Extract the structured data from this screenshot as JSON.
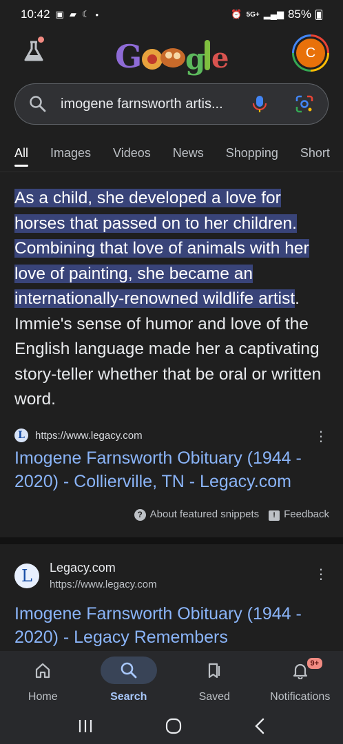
{
  "status_bar": {
    "time": "10:42",
    "network": "5G+",
    "battery": "85%"
  },
  "header": {
    "doodle_alt": "Google",
    "avatar_initial": "C"
  },
  "search": {
    "query": "imogene farnsworth artis..."
  },
  "tabs": [
    "All",
    "Images",
    "Videos",
    "News",
    "Shopping",
    "Short"
  ],
  "snippet": {
    "highlighted": "As a child, she developed a love for horses that passed on to her children. Combining that love of animals with her love of painting, she became an internationally-renowned wildlife artist",
    "rest": ". Immie's sense of humor and love of the English language made her a captivating story-teller whether that be oral or written word.",
    "source_url": "https://www.legacy.com",
    "favicon_letter": "L",
    "title": "Imogene Farnsworth Obituary (1944 - 2020) - Collierville, TN - Legacy.com",
    "about_label": "About featured snippets",
    "feedback_label": "Feedback"
  },
  "result2": {
    "favicon_letter": "L",
    "site_name": "Legacy.com",
    "url": "https://www.legacy.com",
    "title": "Imogene Farnsworth Obituary (1944 - 2020) - Legacy Remembers"
  },
  "bottom_nav": {
    "items": [
      {
        "label": "Home",
        "icon": "home-icon"
      },
      {
        "label": "Search",
        "icon": "search-icon"
      },
      {
        "label": "Saved",
        "icon": "bookmarks-icon"
      },
      {
        "label": "Notifications",
        "icon": "bell-icon"
      }
    ],
    "badge": "9+"
  },
  "colors": {
    "background": "#1f1f1f",
    "link": "#8ab4f8",
    "highlight": "#394479",
    "avatar": "#e8710a"
  }
}
